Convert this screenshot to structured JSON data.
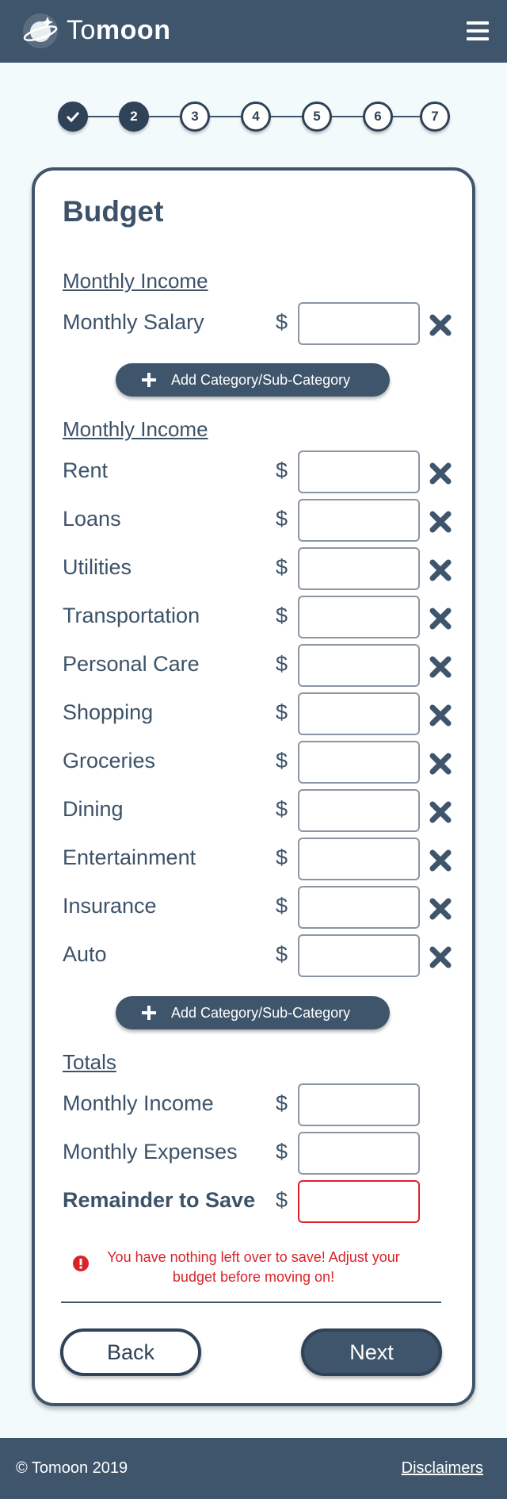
{
  "header": {
    "brand_light": "To",
    "brand_bold": "moon"
  },
  "stepper": {
    "steps": [
      {
        "label": "",
        "state": "done"
      },
      {
        "label": "2",
        "state": "active"
      },
      {
        "label": "3",
        "state": "todo"
      },
      {
        "label": "4",
        "state": "todo"
      },
      {
        "label": "5",
        "state": "todo"
      },
      {
        "label": "6",
        "state": "todo"
      },
      {
        "label": "7",
        "state": "todo"
      }
    ]
  },
  "budget": {
    "title": "Budget",
    "currency": "$",
    "income_section": {
      "heading": "Monthly Income",
      "rows": [
        {
          "label": "Monthly Salary",
          "value": ""
        }
      ]
    },
    "add_label": "Add Category/Sub-Category",
    "expense_section": {
      "heading": "Monthly Income",
      "rows": [
        {
          "label": "Rent",
          "value": ""
        },
        {
          "label": "Loans",
          "value": ""
        },
        {
          "label": "Utilities",
          "value": ""
        },
        {
          "label": "Transportation",
          "value": ""
        },
        {
          "label": "Personal Care",
          "value": ""
        },
        {
          "label": "Shopping",
          "value": ""
        },
        {
          "label": "Groceries",
          "value": ""
        },
        {
          "label": "Dining",
          "value": ""
        },
        {
          "label": "Entertainment",
          "value": ""
        },
        {
          "label": "Insurance",
          "value": ""
        },
        {
          "label": "Auto",
          "value": ""
        }
      ]
    },
    "totals": {
      "heading": "Totals",
      "monthly_income": "Monthly Income",
      "monthly_expenses": "Monthly Expenses",
      "remainder": "Remainder to Save"
    },
    "error_message": "You have nothing left over to save! Adjust your budget before moving on!"
  },
  "nav": {
    "back": "Back",
    "next": "Next"
  },
  "footer": {
    "copyright": "© Tomoon 2019",
    "disclaimers": "Disclaimers"
  },
  "colors": {
    "primary": "#3f556b",
    "dark": "#2f4258",
    "background": "#f3fafb",
    "error": "#d8232a"
  }
}
